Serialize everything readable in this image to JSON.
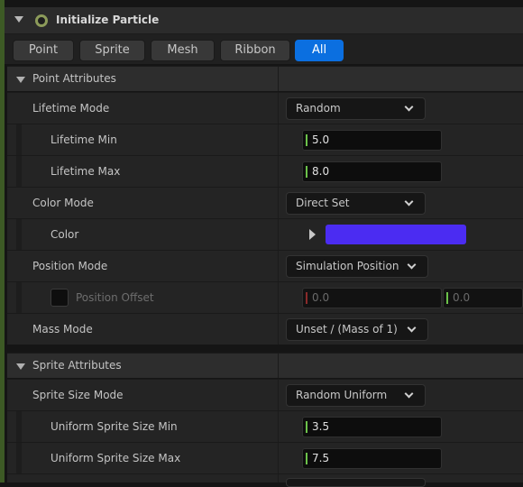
{
  "module": {
    "title": "Initialize Particle"
  },
  "tabs": [
    {
      "label": "Point",
      "active": false
    },
    {
      "label": "Sprite",
      "active": false
    },
    {
      "label": "Mesh",
      "active": false
    },
    {
      "label": "Ribbon",
      "active": false
    },
    {
      "label": "All",
      "active": true
    }
  ],
  "point_attributes": {
    "section_title": "Point Attributes",
    "lifetime_mode": {
      "label": "Lifetime Mode",
      "value": "Random"
    },
    "lifetime_min": {
      "label": "Lifetime Min",
      "value": "5.0"
    },
    "lifetime_max": {
      "label": "Lifetime Max",
      "value": "8.0"
    },
    "color_mode": {
      "label": "Color Mode",
      "value": "Direct Set"
    },
    "color": {
      "label": "Color",
      "swatch": "#4b2cf2"
    },
    "position_mode": {
      "label": "Position Mode",
      "value": "Simulation Position"
    },
    "position_offset": {
      "label": "Position Offset",
      "x": "0.0",
      "y": "0.0",
      "enabled": false
    },
    "mass_mode": {
      "label": "Mass Mode",
      "value": "Unset / (Mass of 1)"
    }
  },
  "sprite_attributes": {
    "section_title": "Sprite Attributes",
    "sprite_size_mode": {
      "label": "Sprite Size Mode",
      "value": "Random Uniform"
    },
    "uniform_size_min": {
      "label": "Uniform Sprite Size Min",
      "value": "3.5"
    },
    "uniform_size_max": {
      "label": "Uniform Sprite Size Max",
      "value": "7.5"
    }
  },
  "colors": {
    "accent": "#0b6fe0",
    "module_strip": "#3d5a25",
    "value_tick": "#6cc24a"
  }
}
